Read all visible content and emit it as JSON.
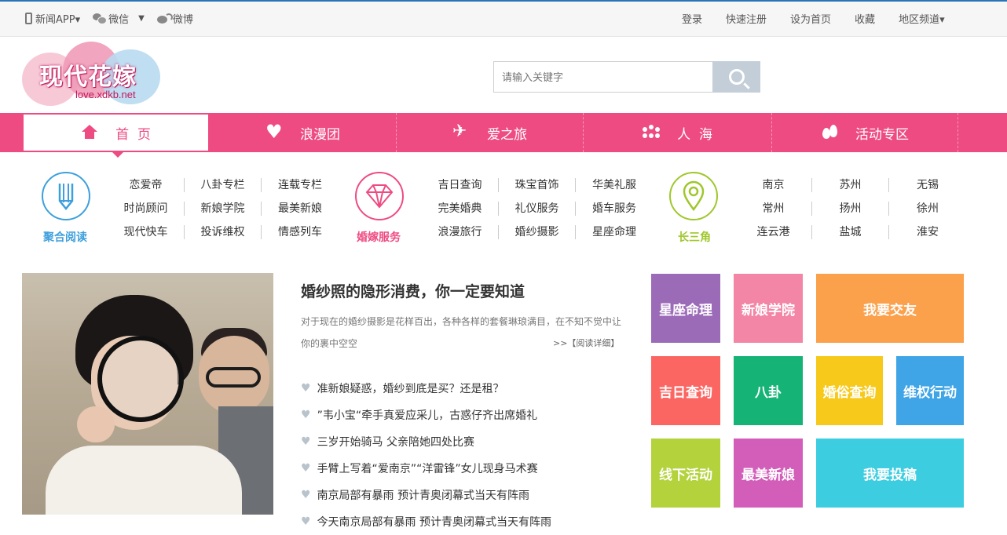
{
  "topbar": {
    "app_label": "新闻APP▾",
    "wechat_label": "微信",
    "weibo_label": "微博",
    "login": "登录",
    "register": "快速注册",
    "set_home": "设为首页",
    "favorite": "收藏",
    "region": "地区频道▾"
  },
  "logo": {
    "title": "现代花嫁",
    "domain": "love.xdkb.net"
  },
  "search": {
    "placeholder": "请输入关键字"
  },
  "nav": [
    {
      "label": "首  页",
      "icon": "home-icon"
    },
    {
      "label": "浪漫团",
      "icon": "love-heart-icon"
    },
    {
      "label": "爱之旅",
      "icon": "airplane-icon"
    },
    {
      "label": "人  海",
      "icon": "people-icon"
    },
    {
      "label": "活动专区",
      "icon": "drops-icon"
    }
  ],
  "categories": [
    {
      "label": "聚合阅读",
      "color": "#3d9fdc",
      "links": [
        "恋爱帝",
        "八卦专栏",
        "连载专栏",
        "时尚顾问",
        "新娘学院",
        "最美新娘",
        "现代快车",
        "投诉维权",
        "情感列车"
      ]
    },
    {
      "label": "婚嫁服务",
      "color": "#ee4b82",
      "links": [
        "吉日查询",
        "珠宝首饰",
        "华美礼服",
        "完美婚典",
        "礼仪服务",
        "婚车服务",
        "浪漫旅行",
        "婚纱摄影",
        "星座命理"
      ]
    },
    {
      "label": "长三角",
      "color": "#9fc72c",
      "links": [
        "南京",
        "苏州",
        "无锡",
        "常州",
        "扬州",
        "徐州",
        "连云港",
        "盐城",
        "淮安"
      ]
    }
  ],
  "feature": {
    "headline": "婚纱照的隐形消费，你一定要知道",
    "summary": "对于现在的婚纱摄影是花样百出，各种各样的套餐琳琅满目，在不知不觉中让你的裹中空空",
    "read_more": ">>【阅读详细】"
  },
  "news": [
    "准新娘疑惑，婚纱到底是买？还是租？",
    "”韦小宝“牵手真爱应采儿，古惑仔齐出席婚礼",
    "三岁开始骑马 父亲陪她四处比赛",
    "手臂上写着“爱南京”“洋雷锋”女儿现身马术赛",
    "南京局部有暴雨 预计青奥闭幕式当天有阵雨",
    "今天南京局部有暴雨 预计青奥闭幕式当天有阵雨"
  ],
  "tiles": [
    {
      "label": "星座命理",
      "color": "#9b6bb8"
    },
    {
      "label": "新娘学院",
      "color": "#f386a6"
    },
    {
      "label": "我要交友",
      "color": "#fba04b"
    },
    {
      "label": "吉日查询",
      "color": "#fb6662"
    },
    {
      "label": "八卦",
      "color": "#15b376"
    },
    {
      "label": "婚俗查询",
      "color": "#f6c91a"
    },
    {
      "label": "维权行动",
      "color": "#3fa5e6"
    },
    {
      "label": "线下活动",
      "color": "#b3d23b"
    },
    {
      "label": "最美新娘",
      "color": "#d25eba"
    },
    {
      "label": "我要投稿",
      "color": "#3ccde0"
    }
  ]
}
